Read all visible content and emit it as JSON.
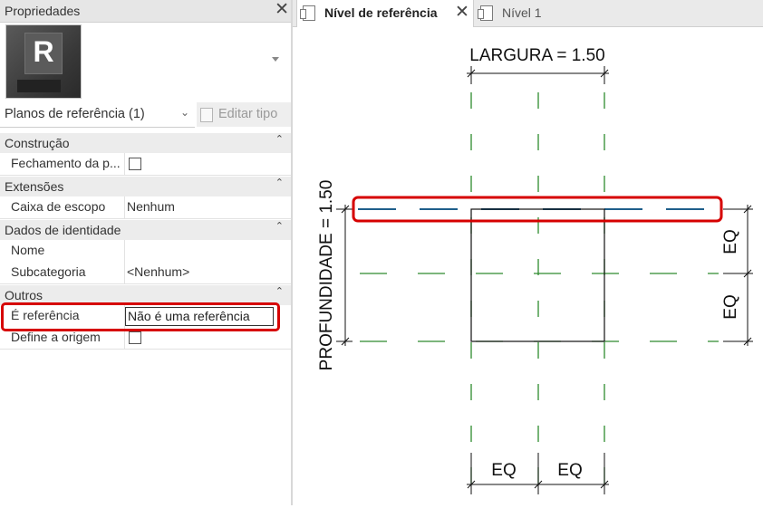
{
  "properties": {
    "title": "Propriedades",
    "close_icon": "close-icon",
    "logo_letter": "R",
    "type_selector": "Planos de referência (1)",
    "edit_type": "Editar tipo",
    "sections": [
      {
        "title": "Construção",
        "rows": [
          {
            "key": "Fechamento da p...",
            "checkbox": true,
            "checked": false
          }
        ]
      },
      {
        "title": "Extensões",
        "rows": [
          {
            "key": "Caixa de escopo",
            "value": "Nenhum"
          }
        ]
      },
      {
        "title": "Dados de identidade",
        "rows": [
          {
            "key": "Nome",
            "value": ""
          },
          {
            "key": "Subcategoria",
            "value": "<Nenhum>"
          }
        ]
      },
      {
        "title": "Outros",
        "rows": [
          {
            "key": "É referência",
            "value": "Não é uma referência"
          },
          {
            "key": "Define a origem",
            "checkbox": true,
            "checked": false
          }
        ]
      }
    ],
    "collapse_glyph": "⌃"
  },
  "tabs": [
    {
      "label": "Nível de referência",
      "active": true,
      "close": "close-icon"
    },
    {
      "label": "Nível 1",
      "active": false
    }
  ],
  "drawing": {
    "width_label": "LARGURA = 1.50",
    "depth_label": "PROFUNDIDADE = 1.50",
    "eq_label": "EQ",
    "colors": {
      "ref_plane_green": "#2e8b2e",
      "selected_plane_blue": "#1f5f8b",
      "highlight_red": "#d60000"
    }
  }
}
